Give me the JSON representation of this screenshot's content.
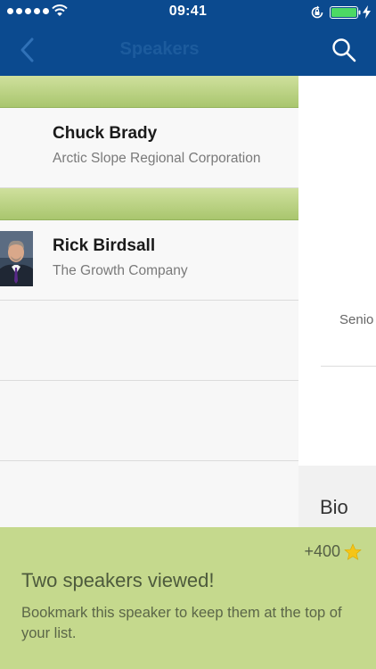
{
  "status_bar": {
    "time": "09:41"
  },
  "nav": {
    "title": "Speakers"
  },
  "speakers": [
    {
      "name": "Chuck Brady",
      "company": "Arctic Slope Regional Corporation"
    },
    {
      "name": "Rick Birdsall",
      "company": "The Growth Company"
    }
  ],
  "detail": {
    "title_fragment": "Senio",
    "bio_label": "Bio"
  },
  "toast": {
    "points": "+400",
    "title": "Two speakers viewed!",
    "message": "Bookmark this speaker to keep them at the top of your list."
  },
  "colors": {
    "nav_blue": "#0b4a8f",
    "section_green": "#b8d27e",
    "toast_green": "#c5d98d",
    "star_yellow": "#f5c518"
  }
}
